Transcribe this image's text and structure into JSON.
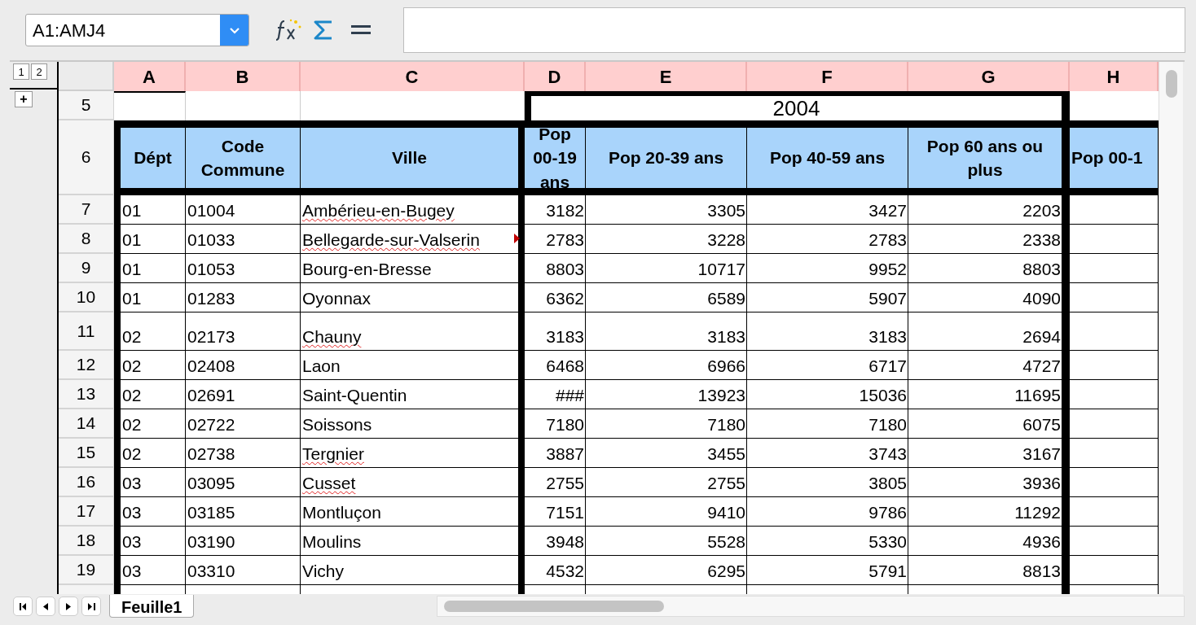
{
  "toolbar": {
    "name_box": "A1:AMJ4"
  },
  "outline_levels": [
    "1",
    "2"
  ],
  "outline_toggle": "+",
  "columns": [
    "A",
    "B",
    "C",
    "D",
    "E",
    "F",
    "G",
    "H"
  ],
  "title_row": {
    "number": "5",
    "title": "2004"
  },
  "header_row": {
    "number": "6",
    "cells": [
      "Dépt",
      "Code Commune",
      "Ville",
      "Pop 00-19 ans",
      "Pop 20-39 ans",
      "Pop 40-59 ans",
      "Pop 60 ans ou plus",
      "Pop 00-1"
    ]
  },
  "rows": [
    {
      "number": "7",
      "cells": [
        "01",
        "01004",
        "Ambérieu-en-Bugey",
        "3182",
        "3305",
        "3427",
        "2203"
      ],
      "misspelled": true,
      "overflow": false,
      "tall": false
    },
    {
      "number": "8",
      "cells": [
        "01",
        "01033",
        "Bellegarde-sur-Valserin",
        "2783",
        "3228",
        "2783",
        "2338"
      ],
      "misspelled": true,
      "overflow": true,
      "tall": false
    },
    {
      "number": "9",
      "cells": [
        "01",
        "01053",
        "Bourg-en-Bresse",
        "8803",
        "10717",
        "9952",
        "8803"
      ],
      "misspelled": false,
      "overflow": false,
      "tall": false
    },
    {
      "number": "10",
      "cells": [
        "01",
        "01283",
        "Oyonnax",
        "6362",
        "6589",
        "5907",
        "4090"
      ],
      "misspelled": false,
      "overflow": false,
      "tall": false
    },
    {
      "number": "11",
      "cells": [
        "02",
        "02173",
        "Chauny",
        "3183",
        "3183",
        "3183",
        "2694"
      ],
      "misspelled": true,
      "overflow": false,
      "tall": true
    },
    {
      "number": "12",
      "cells": [
        "02",
        "02408",
        "Laon",
        "6468",
        "6966",
        "6717",
        "4727"
      ],
      "misspelled": false,
      "overflow": false,
      "tall": false
    },
    {
      "number": "13",
      "cells": [
        "02",
        "02691",
        "Saint-Quentin",
        "###",
        "13923",
        "15036",
        "11695"
      ],
      "misspelled": false,
      "overflow": false,
      "tall": false
    },
    {
      "number": "14",
      "cells": [
        "02",
        "02722",
        "Soissons",
        "7180",
        "7180",
        "7180",
        "6075"
      ],
      "misspelled": false,
      "overflow": false,
      "tall": false
    },
    {
      "number": "15",
      "cells": [
        "02",
        "02738",
        "Tergnier",
        "3887",
        "3455",
        "3743",
        "3167"
      ],
      "misspelled": true,
      "overflow": false,
      "tall": false
    },
    {
      "number": "16",
      "cells": [
        "03",
        "03095",
        "Cusset",
        "2755",
        "2755",
        "3805",
        "3936"
      ],
      "misspelled": true,
      "overflow": false,
      "tall": false
    },
    {
      "number": "17",
      "cells": [
        "03",
        "03185",
        "Montluçon",
        "7151",
        "9410",
        "9786",
        "11292"
      ],
      "misspelled": false,
      "overflow": false,
      "tall": false
    },
    {
      "number": "18",
      "cells": [
        "03",
        "03190",
        "Moulins",
        "3948",
        "5528",
        "5330",
        "4936"
      ],
      "misspelled": false,
      "overflow": false,
      "tall": false
    },
    {
      "number": "19",
      "cells": [
        "03",
        "03310",
        "Vichy",
        "4532",
        "6295",
        "5791",
        "8813"
      ],
      "misspelled": false,
      "overflow": false,
      "tall": false
    }
  ],
  "sheet_tabs": [
    {
      "label": "Feuille1",
      "selected": true
    }
  ]
}
